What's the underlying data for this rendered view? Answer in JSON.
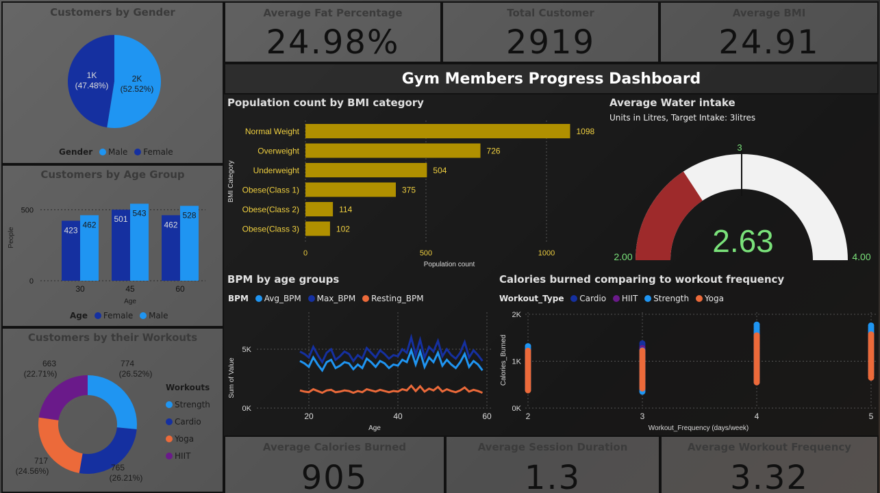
{
  "colors": {
    "female": "#1530a0",
    "male": "#1f95f2",
    "bar_gold": "#b09000",
    "cardio": "#1530a0",
    "hiit": "#6a1a8a",
    "strength": "#1f95f2",
    "yoga": "#ec6a3a",
    "gauge_red": "#9e2a2b",
    "gauge_white": "#f2f2f2",
    "gauge_value": "#7ae27a"
  },
  "kpis": {
    "fat": {
      "title": "Average Fat Percentage",
      "value": "24.98%"
    },
    "customers": {
      "title": "Total Customer",
      "value": "2919"
    },
    "bmi": {
      "title": "Average BMI",
      "value": "24.91"
    },
    "calories": {
      "title": "Average Calories Burned",
      "value": "905"
    },
    "session": {
      "title": "Average Session Duration",
      "value": "1.3"
    },
    "frequency": {
      "title": "Average Workout Frequency",
      "value": "3.32"
    }
  },
  "dashboard_title": "Gym Members Progress Dashboard",
  "gender": {
    "title": "Customers by Gender",
    "legend_title": "Gender",
    "legend": [
      "Male",
      "Female"
    ],
    "female_label": [
      "1K",
      "(47.48%)"
    ],
    "male_label": [
      "2K",
      "(52.52%)"
    ]
  },
  "age": {
    "title": "Customers by Age Group",
    "ylabel": "People",
    "xlabel": "Age",
    "legend_title": "Age",
    "legend": [
      "Female",
      "Male"
    ]
  },
  "workouts": {
    "title": "Customers by their Workouts",
    "legend_title": "Workouts",
    "legend": [
      "Strength",
      "Cardio",
      "Yoga",
      "HIIT"
    ],
    "labels": [
      [
        "774",
        "(26.52%)"
      ],
      [
        "765",
        "(26.21%)"
      ],
      [
        "717",
        "(24.56%)"
      ],
      [
        "663",
        "(22.71%)"
      ]
    ]
  },
  "bmi_cat": {
    "title": "Population count by BMI category",
    "ylabel": "BMI Category",
    "xlabel": "Population count"
  },
  "water": {
    "title": "Average Water intake",
    "subtitle": "Units in Litres, Target Intake: 3litres",
    "value": "2.63",
    "min": "2.00",
    "max": "4.00",
    "target": "3"
  },
  "bpm": {
    "title": "BPM by age groups",
    "legend_title": "BPM",
    "legend": [
      "Avg_BPM",
      "Max_BPM",
      "Resting_BPM"
    ],
    "ylabel": "Sum of Value",
    "xlabel": "Age"
  },
  "calories_chart": {
    "title": "Calories burned comparing to workout frequency",
    "legend_title": "Workout_Type",
    "legend": [
      "Cardio",
      "HIIT",
      "Strength",
      "Yoga"
    ],
    "ylabel": "Calories_Burned",
    "xlabel": "Workout_Frequency (days/week)"
  },
  "chart_data": [
    {
      "type": "pie",
      "title": "Customers by Gender",
      "categories": [
        "Female",
        "Male"
      ],
      "values": [
        1386,
        1533
      ],
      "percent": [
        47.48,
        52.52
      ]
    },
    {
      "type": "bar",
      "title": "Customers by Age Group",
      "categories": [
        "30",
        "45",
        "60"
      ],
      "series": [
        {
          "name": "Female",
          "values": [
            423,
            501,
            462
          ]
        },
        {
          "name": "Male",
          "values": [
            462,
            543,
            528
          ]
        }
      ],
      "ylim": [
        0,
        560
      ],
      "yticks": [
        0,
        500
      ],
      "xlabel": "Age",
      "ylabel": "People"
    },
    {
      "type": "pie",
      "title": "Customers by their Workouts",
      "donut": true,
      "categories": [
        "Strength",
        "Cardio",
        "Yoga",
        "HIIT"
      ],
      "values": [
        774,
        765,
        717,
        663
      ],
      "percent": [
        26.52,
        26.21,
        24.56,
        22.71
      ]
    },
    {
      "type": "bar",
      "orientation": "horizontal",
      "title": "Population count by BMI category",
      "categories": [
        "Normal Weight",
        "Overweight",
        "Underweight",
        "Obese(Class 1)",
        "Obese(Class 2)",
        "Obese(Class 3)"
      ],
      "values": [
        1098,
        726,
        504,
        375,
        114,
        102
      ],
      "xlim": [
        0,
        1200
      ],
      "xticks": [
        0,
        500,
        1000
      ],
      "xlabel": "Population count",
      "ylabel": "BMI Category"
    },
    {
      "type": "gauge",
      "title": "Average Water intake",
      "value": 2.63,
      "min": 2.0,
      "max": 4.0,
      "target": 3
    },
    {
      "type": "line",
      "title": "BPM by age groups",
      "x": [
        18,
        19,
        20,
        21,
        22,
        23,
        24,
        25,
        26,
        27,
        28,
        29,
        30,
        31,
        32,
        33,
        34,
        35,
        36,
        37,
        38,
        39,
        40,
        41,
        42,
        43,
        44,
        45,
        46,
        47,
        48,
        49,
        50,
        51,
        52,
        53,
        54,
        55,
        56,
        57,
        58,
        59
      ],
      "series": [
        {
          "name": "Max_BPM",
          "values": [
            4800,
            4600,
            4300,
            5200,
            4500,
            3900,
            4700,
            5000,
            4100,
            4400,
            4800,
            4600,
            4000,
            4500,
            4200,
            5100,
            4700,
            4300,
            4900,
            4600,
            4200,
            4500,
            4400,
            5000,
            4700,
            6000,
            4500,
            5800,
            4300,
            5200,
            4800,
            5700,
            4400,
            5000,
            4500,
            4200,
            4700,
            5600,
            4300,
            4900,
            4500,
            4000
          ]
        },
        {
          "name": "Avg_BPM",
          "values": [
            4000,
            3800,
            3500,
            4300,
            3700,
            3200,
            3900,
            4100,
            3400,
            3600,
            3900,
            3800,
            3300,
            3700,
            3400,
            4200,
            3900,
            3500,
            4000,
            3800,
            3400,
            3700,
            3600,
            4100,
            3900,
            4900,
            3700,
            4800,
            3500,
            4300,
            3900,
            4700,
            3600,
            4100,
            3700,
            3400,
            3900,
            4600,
            3500,
            4000,
            3700,
            3200
          ]
        },
        {
          "name": "Resting_BPM",
          "values": [
            1500,
            1400,
            1350,
            1600,
            1450,
            1300,
            1500,
            1550,
            1350,
            1400,
            1500,
            1450,
            1300,
            1450,
            1350,
            1600,
            1500,
            1400,
            1550,
            1450,
            1350,
            1450,
            1400,
            1600,
            1500,
            1900,
            1450,
            1850,
            1400,
            1650,
            1500,
            1800,
            1400,
            1600,
            1450,
            1350,
            1500,
            1750,
            1400,
            1550,
            1450,
            1300
          ]
        }
      ],
      "ylim": [
        0,
        6500
      ],
      "yticks": [
        0,
        5000
      ],
      "xticks": [
        20,
        40,
        60
      ],
      "xlabel": "Age",
      "ylabel": "Sum of Value"
    },
    {
      "type": "scatter",
      "title": "Calories burned comparing to workout frequency",
      "x_categories": [
        2,
        3,
        4,
        5
      ],
      "series": [
        {
          "name": "Cardio",
          "ranges": [
            [
              400,
              1300
            ],
            [
              380,
              1380
            ],
            [
              550,
              1650
            ],
            [
              700,
              1700
            ]
          ]
        },
        {
          "name": "HIIT",
          "ranges": [
            [
              420,
              1250
            ],
            [
              400,
              1300
            ],
            [
              600,
              1600
            ],
            [
              720,
              1650
            ]
          ]
        },
        {
          "name": "Strength",
          "ranges": [
            [
              400,
              1320
            ],
            [
              350,
              1250
            ],
            [
              580,
              1800
            ],
            [
              720,
              1780
            ]
          ]
        },
        {
          "name": "Yoga",
          "ranges": [
            [
              380,
              1250
            ],
            [
              420,
              1220
            ],
            [
              550,
              1550
            ],
            [
              650,
              1600
            ]
          ]
        }
      ],
      "ylim": [
        0,
        2000
      ],
      "yticks": [
        0,
        1000,
        2000
      ],
      "xlabel": "Workout_Frequency (days/week)",
      "ylabel": "Calories_Burned"
    }
  ]
}
